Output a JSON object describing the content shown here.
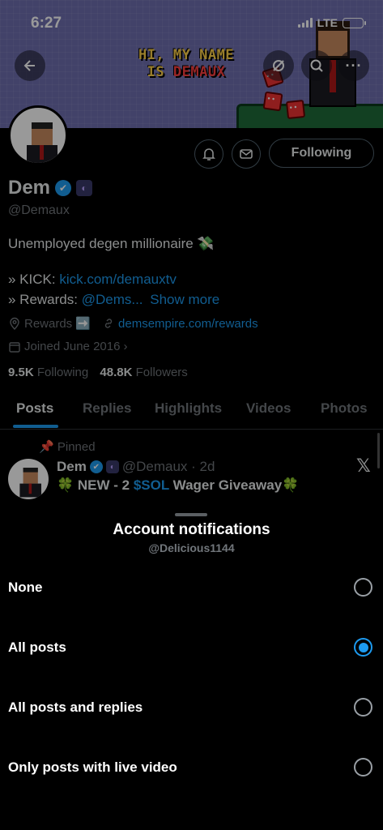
{
  "status_bar": {
    "time": "6:27",
    "network": "LTE"
  },
  "banner": {
    "title_line1": "HI, MY NAME",
    "title_line2_prefix": "IS ",
    "title_line2_name": "DEMAUX"
  },
  "profile": {
    "name": "Dem",
    "handle": "@Demaux",
    "following_label": "Following",
    "bio": "Unemployed degen millionaire 💸",
    "kick_label": "» KICK: ",
    "kick_link": "kick.com/demauxtv",
    "rewards_label": "» Rewards: ",
    "rewards_link": "@Dems...",
    "show_more": "Show more",
    "meta_rewards": "Rewards ➡️",
    "meta_link": "demsempire.com/rewards",
    "joined": "Joined June 2016",
    "following_count": "9.5K",
    "following_text": "Following",
    "followers_count": "48.8K",
    "followers_text": "Followers"
  },
  "tabs": [
    "Posts",
    "Replies",
    "Highlights",
    "Videos",
    "Photos"
  ],
  "post": {
    "pinned_label": "Pinned",
    "author": "Dem",
    "handle_time": "@Demaux · 2d",
    "text_prefix": "🍀 NEW - 2 ",
    "text_link": "$SOL",
    "text_suffix": " Wager Giveaway🍀"
  },
  "sheet": {
    "title": "Account notifications",
    "subtitle": "@Delicious1144",
    "options": [
      {
        "label": "None",
        "selected": false
      },
      {
        "label": "All posts",
        "selected": true
      },
      {
        "label": "All posts and replies",
        "selected": false
      },
      {
        "label": "Only posts with live video",
        "selected": false
      }
    ]
  },
  "colors": {
    "accent": "#1d9bf0",
    "muted": "#71767b",
    "background": "#000000"
  }
}
